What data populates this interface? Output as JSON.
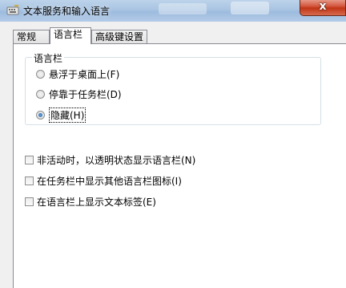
{
  "window": {
    "title": "文本服务和输入语言",
    "close_glyph": "x"
  },
  "tabs": [
    {
      "label": "常规"
    },
    {
      "label": "语言栏"
    },
    {
      "label": "高级键设置"
    }
  ],
  "language_bar": {
    "group_title": "语言栏",
    "options": [
      {
        "label": "悬浮于桌面上(F)",
        "checked": false
      },
      {
        "label": "停靠于任务栏(D)",
        "checked": false
      },
      {
        "label": "隐藏(H)",
        "checked": true
      }
    ]
  },
  "checkboxes": [
    {
      "label": "非活动时，以透明状态显示语言栏(N)",
      "checked": false
    },
    {
      "label": "在任务栏中显示其他语言栏图标(I)",
      "checked": false
    },
    {
      "label": "在语言栏上显示文本标签(E)",
      "checked": false
    }
  ],
  "colors": {
    "accent": "#1c5ea8",
    "close": "#c13515"
  },
  "icons": {
    "app": "keyboard-icon"
  }
}
